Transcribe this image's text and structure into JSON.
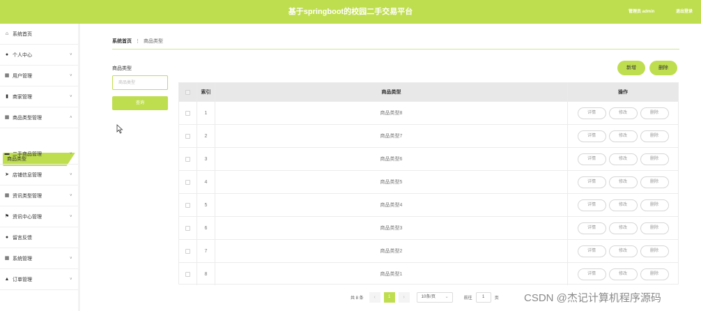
{
  "header": {
    "title": "基于springboot的校园二手交易平台",
    "admin_label": "管理员 admin",
    "logout_label": "退出登录"
  },
  "sidebar": {
    "items": [
      {
        "label": "系统首页",
        "icon": "home-icon",
        "glyph": "⌂",
        "expandable": false
      },
      {
        "label": "个人中心",
        "icon": "person-icon",
        "glyph": "●",
        "expandable": true
      },
      {
        "label": "用户管理",
        "icon": "grid-icon",
        "glyph": "▦",
        "expandable": true
      },
      {
        "label": "商家管理",
        "icon": "bar-chart-icon",
        "glyph": "▮",
        "expandable": true
      },
      {
        "label": "商品类型管理",
        "icon": "grid-icon",
        "glyph": "▦",
        "expandable": true
      },
      {
        "label": "二手商品管理",
        "icon": "chat-icon",
        "glyph": "▬",
        "expandable": true
      },
      {
        "label": "店铺信息管理",
        "icon": "send-icon",
        "glyph": "➤",
        "expandable": true
      },
      {
        "label": "资讯类型管理",
        "icon": "grid-icon",
        "glyph": "▦",
        "expandable": true
      },
      {
        "label": "资讯中心管理",
        "icon": "flag-icon",
        "glyph": "⚑",
        "expandable": true
      },
      {
        "label": "留言反馈",
        "icon": "person-icon",
        "glyph": "●",
        "expandable": false
      },
      {
        "label": "系统管理",
        "icon": "grid-icon",
        "glyph": "▦",
        "expandable": true
      },
      {
        "label": "订单管理",
        "icon": "thumb-icon",
        "glyph": "▲",
        "expandable": true
      }
    ],
    "active_sub": "商品类型"
  },
  "breadcrumb": {
    "home": "系统首页",
    "current": "商品类型"
  },
  "search": {
    "label": "商品类型",
    "placeholder": "商品类型",
    "query_label": "查询"
  },
  "actions": {
    "add_label": "新增",
    "delete_label": "删除"
  },
  "table": {
    "headers": {
      "index": "索引",
      "name": "商品类型",
      "ops": "操作"
    },
    "rows": [
      {
        "index": "1",
        "name": "商品类型8"
      },
      {
        "index": "2",
        "name": "商品类型7"
      },
      {
        "index": "3",
        "name": "商品类型6"
      },
      {
        "index": "4",
        "name": "商品类型5"
      },
      {
        "index": "5",
        "name": "商品类型4"
      },
      {
        "index": "6",
        "name": "商品类型3"
      },
      {
        "index": "7",
        "name": "商品类型2"
      },
      {
        "index": "8",
        "name": "商品类型1"
      }
    ],
    "row_ops": {
      "detail": "详情",
      "edit": "修改",
      "delete": "删除"
    }
  },
  "pagination": {
    "total": "共 8 条",
    "prev": "‹",
    "current_page": "1",
    "next": "›",
    "page_size": "10条/页",
    "goto_label": "前往",
    "goto_value": "1",
    "page_unit": "页"
  },
  "watermark": "CSDN @杰记计算机程序源码",
  "colors": {
    "accent": "#bfde4f"
  }
}
